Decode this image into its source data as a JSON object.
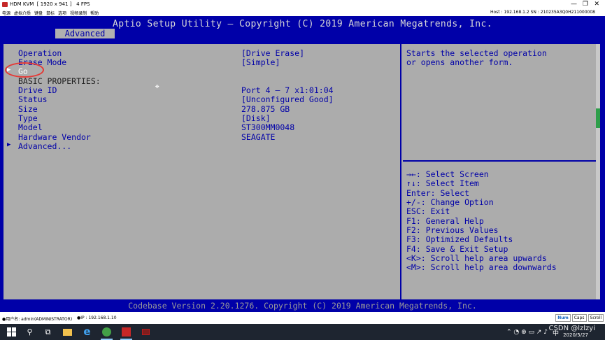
{
  "kvm": {
    "title": "HDM KVM  [ 1920 x 941 ]   4 FPS",
    "minimize": "—",
    "restore": "❐",
    "close": "✕",
    "menu": [
      "电源",
      "虚拟介质",
      "键盘",
      "鼠标",
      "选项",
      "视频录制",
      "帮助"
    ],
    "host_info": "Host : 192.168.1.2    SN : 210235A3Q0H211000008"
  },
  "bios": {
    "title": "Aptio Setup Utility – Copyright (C) 2019 American Megatrends, Inc.",
    "tab": "Advanced",
    "footer": "Codebase Version 2.20.1276. Copyright (C) 2019 American Megatrends, Inc.",
    "rows": {
      "operation": {
        "label": "Operation",
        "value": "[Drive Erase]"
      },
      "erase_mode": {
        "label": "Erase Mode",
        "value": "[Simple]"
      },
      "go": {
        "label": "Go",
        "arrow": "▶"
      },
      "basic_properties": {
        "label": "BASIC PROPERTIES:"
      },
      "drive_id": {
        "label": "Drive ID",
        "value": "Port 4 – 7 x1:01:04"
      },
      "status": {
        "label": "Status",
        "value": "[Unconfigured Good]"
      },
      "size": {
        "label": "Size",
        "value": "278.875 GB"
      },
      "type": {
        "label": "Type",
        "value": "[Disk]"
      },
      "model": {
        "label": "Model",
        "value": "ST300MM0048"
      },
      "hardware_vendor": {
        "label": "Hardware Vendor",
        "value": "SEAGATE"
      },
      "advanced": {
        "label": "Advanced...",
        "arrow": "▶"
      }
    },
    "help_text": [
      "Starts the selected operation",
      "or opens another form."
    ],
    "keys": [
      "→←: Select Screen",
      "↑↓: Select Item",
      "Enter: Select",
      "+/-: Change Option",
      "ESC: Exit",
      "F1: General Help",
      "F2: Previous Values",
      "F3: Optimized Defaults",
      "F4: Save & Exit Setup",
      "<K>: Scroll help area upwards",
      "<M>: Scroll help area downwards"
    ]
  },
  "status_bar": {
    "user": "●用户名: admin(ADMINISTRATOR)",
    "ip": "●IP : 192.168.1.10",
    "buttons": [
      "Num",
      "Caps",
      "Scroll"
    ]
  },
  "taskbar": {
    "ie_glyph": "e",
    "tray_icons": "⌃  ◔  ⊕  ▭  ↗  ♪",
    "ime": "中",
    "date": "2020/5/27",
    "watermark": "CSDN @lzlzyi"
  }
}
